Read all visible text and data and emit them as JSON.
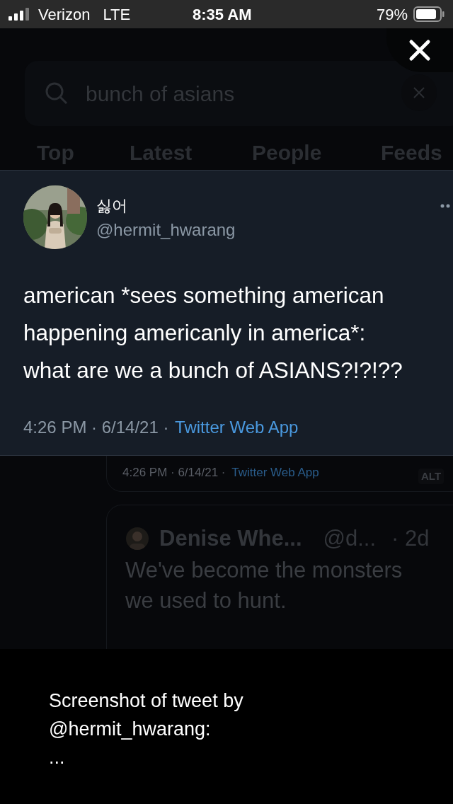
{
  "status_bar": {
    "carrier": "Verizon",
    "network": "LTE",
    "time": "8:35 AM",
    "battery": "79%"
  },
  "search": {
    "value": "bunch of asians"
  },
  "tabs": [
    {
      "label": "Top"
    },
    {
      "label": "Latest"
    },
    {
      "label": "People"
    },
    {
      "label": "Feeds"
    }
  ],
  "image": {
    "kind": "tweet_screenshot",
    "author_name": "싫어",
    "handle": "@hermit_hwarang",
    "text_lines": [
      "american *sees something american",
      "happening americanly in america*:",
      "what are we a bunch of ASIANS?!?!??"
    ],
    "time": "4:26 PM · 6/14/21 · ",
    "source": "Twitter Web App"
  },
  "background_tweets": [
    {
      "kind": "meta",
      "time": "4:26 PM · 6/14/21 · ",
      "source": "Twitter Web App",
      "badge": "ALT"
    },
    {
      "kind": "quote",
      "name": "Denise Whe...",
      "handle": "@d...",
      "age": "· 2d",
      "text": "We've become the monsters we used to hunt."
    }
  ],
  "caption": {
    "lines": [
      "Screenshot of tweet by",
      "@hermit_hwarang:",
      "..."
    ]
  }
}
